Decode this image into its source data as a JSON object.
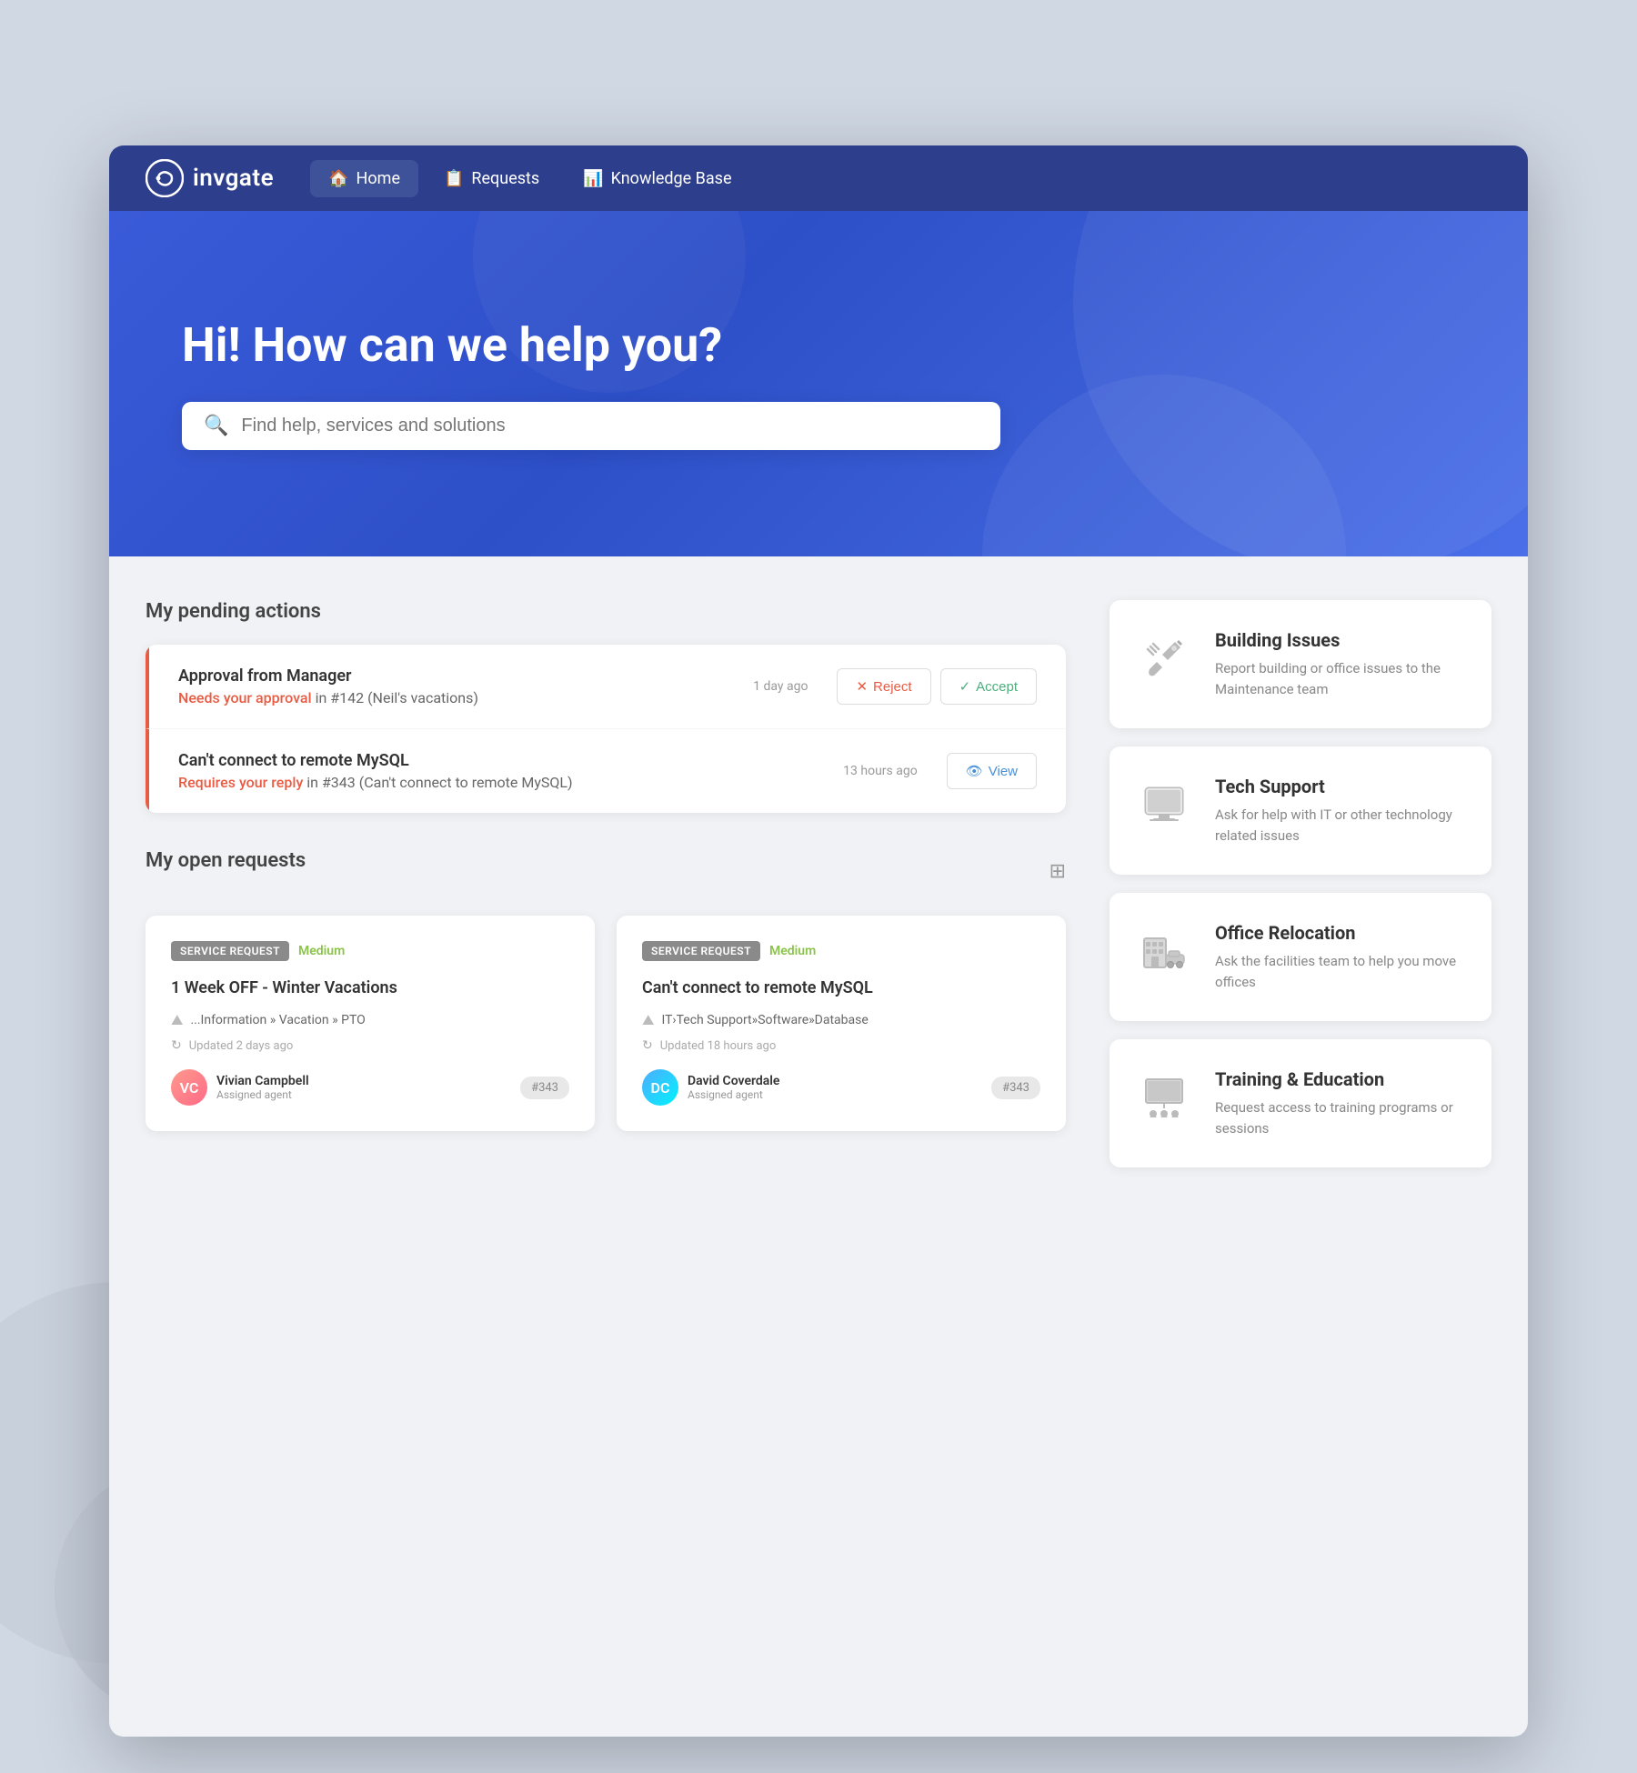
{
  "page": {
    "background_color": "#d0d8e4"
  },
  "navbar": {
    "logo_text": "invgate",
    "items": [
      {
        "id": "home",
        "label": "Home",
        "active": true,
        "icon": "🏠"
      },
      {
        "id": "requests",
        "label": "Requests",
        "active": false,
        "icon": "📋"
      },
      {
        "id": "knowledge",
        "label": "Knowledge Base",
        "active": false,
        "icon": "📊"
      }
    ]
  },
  "hero": {
    "title": "Hi! How can we help you?",
    "search_placeholder": "Find help, services and solutions"
  },
  "pending_actions": {
    "section_title": "My pending actions",
    "items": [
      {
        "title": "Approval from Manager",
        "status_label": "Needs your approval",
        "ref": "in #142 (Neil's vacations)",
        "time": "1 day ago",
        "actions": [
          "Reject",
          "Accept"
        ]
      },
      {
        "title": "Can't connect to remote MySQL",
        "status_label": "Requires your reply",
        "ref": "in #343 (Can't connect to remote MySQL)",
        "time": "13 hours ago",
        "actions": [
          "View"
        ]
      }
    ]
  },
  "open_requests": {
    "section_title": "My open requests",
    "items": [
      {
        "tag": "SERVICE REQUEST",
        "priority": "Medium",
        "title": "1 Week OFF - Winter Vacations",
        "path": "...Information » Vacation » PTO",
        "updated": "Updated 2 days ago",
        "agent_name": "Vivian Campbell",
        "agent_role": "Assigned agent",
        "ticket": "#343",
        "avatar_initials": "VC",
        "avatar_class": "avatar-vc"
      },
      {
        "tag": "SERVICE REQUEST",
        "priority": "Medium",
        "title": "Can't connect to remote MySQL",
        "path": "IT›Tech Support»Software»Database",
        "updated": "Updated 18 hours ago",
        "agent_name": "David Coverdale",
        "agent_role": "Assigned agent",
        "ticket": "#343",
        "avatar_initials": "DC",
        "avatar_class": "avatar-dc"
      }
    ]
  },
  "catalog": {
    "items": [
      {
        "id": "building-issues",
        "title": "Building Issues",
        "description": "Report building or office issues to the Maintenance team",
        "icon": "tools"
      },
      {
        "id": "tech-support",
        "title": "Tech Support",
        "description": "Ask for help with IT or other technology related issues",
        "icon": "monitor"
      },
      {
        "id": "office-relocation",
        "title": "Office Relocation",
        "description": "Ask the facilities team to help you move offices",
        "icon": "office"
      },
      {
        "id": "training-education",
        "title": "Training & Education",
        "description": "Request access to training programs or sessions",
        "icon": "training"
      }
    ]
  }
}
